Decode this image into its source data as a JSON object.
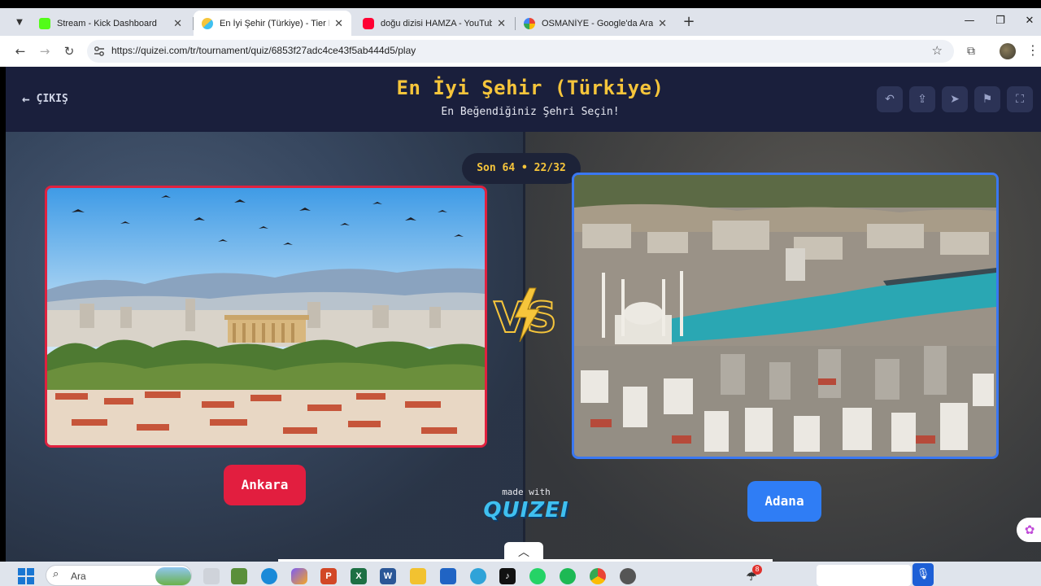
{
  "browser": {
    "tabs": [
      {
        "title": "Stream - Kick Dashboard",
        "favicon_color": "#53fc18",
        "active": false
      },
      {
        "title": "En İyi Şehir (Türkiye) - Tier List,",
        "favicon_color": "#f6c53b",
        "active": true
      },
      {
        "title": "doğu dizisi HAMZA - YouTube",
        "favicon_color": "#ff0033",
        "active": false
      },
      {
        "title": "OSMANİYE - Google'da Ara",
        "favicon_color": "#4285f4",
        "active": false
      }
    ],
    "tab_close_glyph": "✕",
    "new_tab_glyph": "+",
    "url": "https://quizei.com/tr/tournament/quiz/6853f27adc4ce43f5ab444d5/play",
    "window_controls": [
      "—",
      "❐",
      "✕"
    ]
  },
  "page": {
    "exit_label": "ÇIKIŞ",
    "title": "En İyi Şehir (Türkiye)",
    "subtitle": "En Beğendiğiniz Şehri Seçin!",
    "round_label": "Son 64 • 22/32",
    "header_buttons": [
      "undo-icon",
      "share-icon",
      "send-icon",
      "flag-icon",
      "fullscreen-icon"
    ],
    "left_choice": {
      "name": "Ankara",
      "border_color": "#e0213f"
    },
    "right_choice": {
      "name": "Adana",
      "border_color": "#3a78f2"
    },
    "vs_label": "VS",
    "made_with": "made with",
    "brand": "QUIZEI",
    "accent_color": "#f6c53b"
  },
  "taskbar": {
    "search_label": "Ara",
    "badges": {
      "weather_count": "8"
    },
    "apps": [
      "file-icon",
      "minecraft-icon",
      "edge-icon",
      "copilot-icon",
      "powerpoint-icon",
      "excel-icon",
      "word-icon",
      "explorer-icon",
      "calculator-icon",
      "globe-icon",
      "tiktok-icon",
      "whatsapp-icon",
      "spotify-icon",
      "chrome-icon",
      "camera-icon"
    ]
  }
}
